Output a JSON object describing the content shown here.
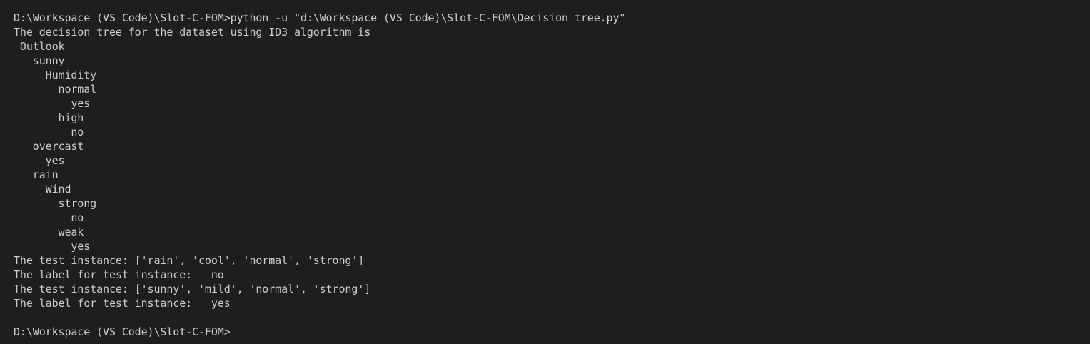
{
  "terminal": {
    "background": "#1e1e1e",
    "foreground": "#cccccc",
    "lines": [
      "D:\\Workspace (VS Code)\\Slot-C-FOM>python -u \"d:\\Workspace (VS Code)\\Slot-C-FOM\\Decision_tree.py\"",
      "The decision tree for the dataset using ID3 algorithm is",
      " Outlook",
      "   sunny",
      "     Humidity",
      "       normal",
      "         yes",
      "       high",
      "         no",
      "   overcast",
      "     yes",
      "   rain",
      "     Wind",
      "       strong",
      "         no",
      "       weak",
      "         yes",
      "The test instance: ['rain', 'cool', 'normal', 'strong']",
      "The label for test instance:   no",
      "The test instance: ['sunny', 'mild', 'normal', 'strong']",
      "The label for test instance:   yes",
      "",
      "D:\\Workspace (VS Code)\\Slot-C-FOM>"
    ]
  }
}
